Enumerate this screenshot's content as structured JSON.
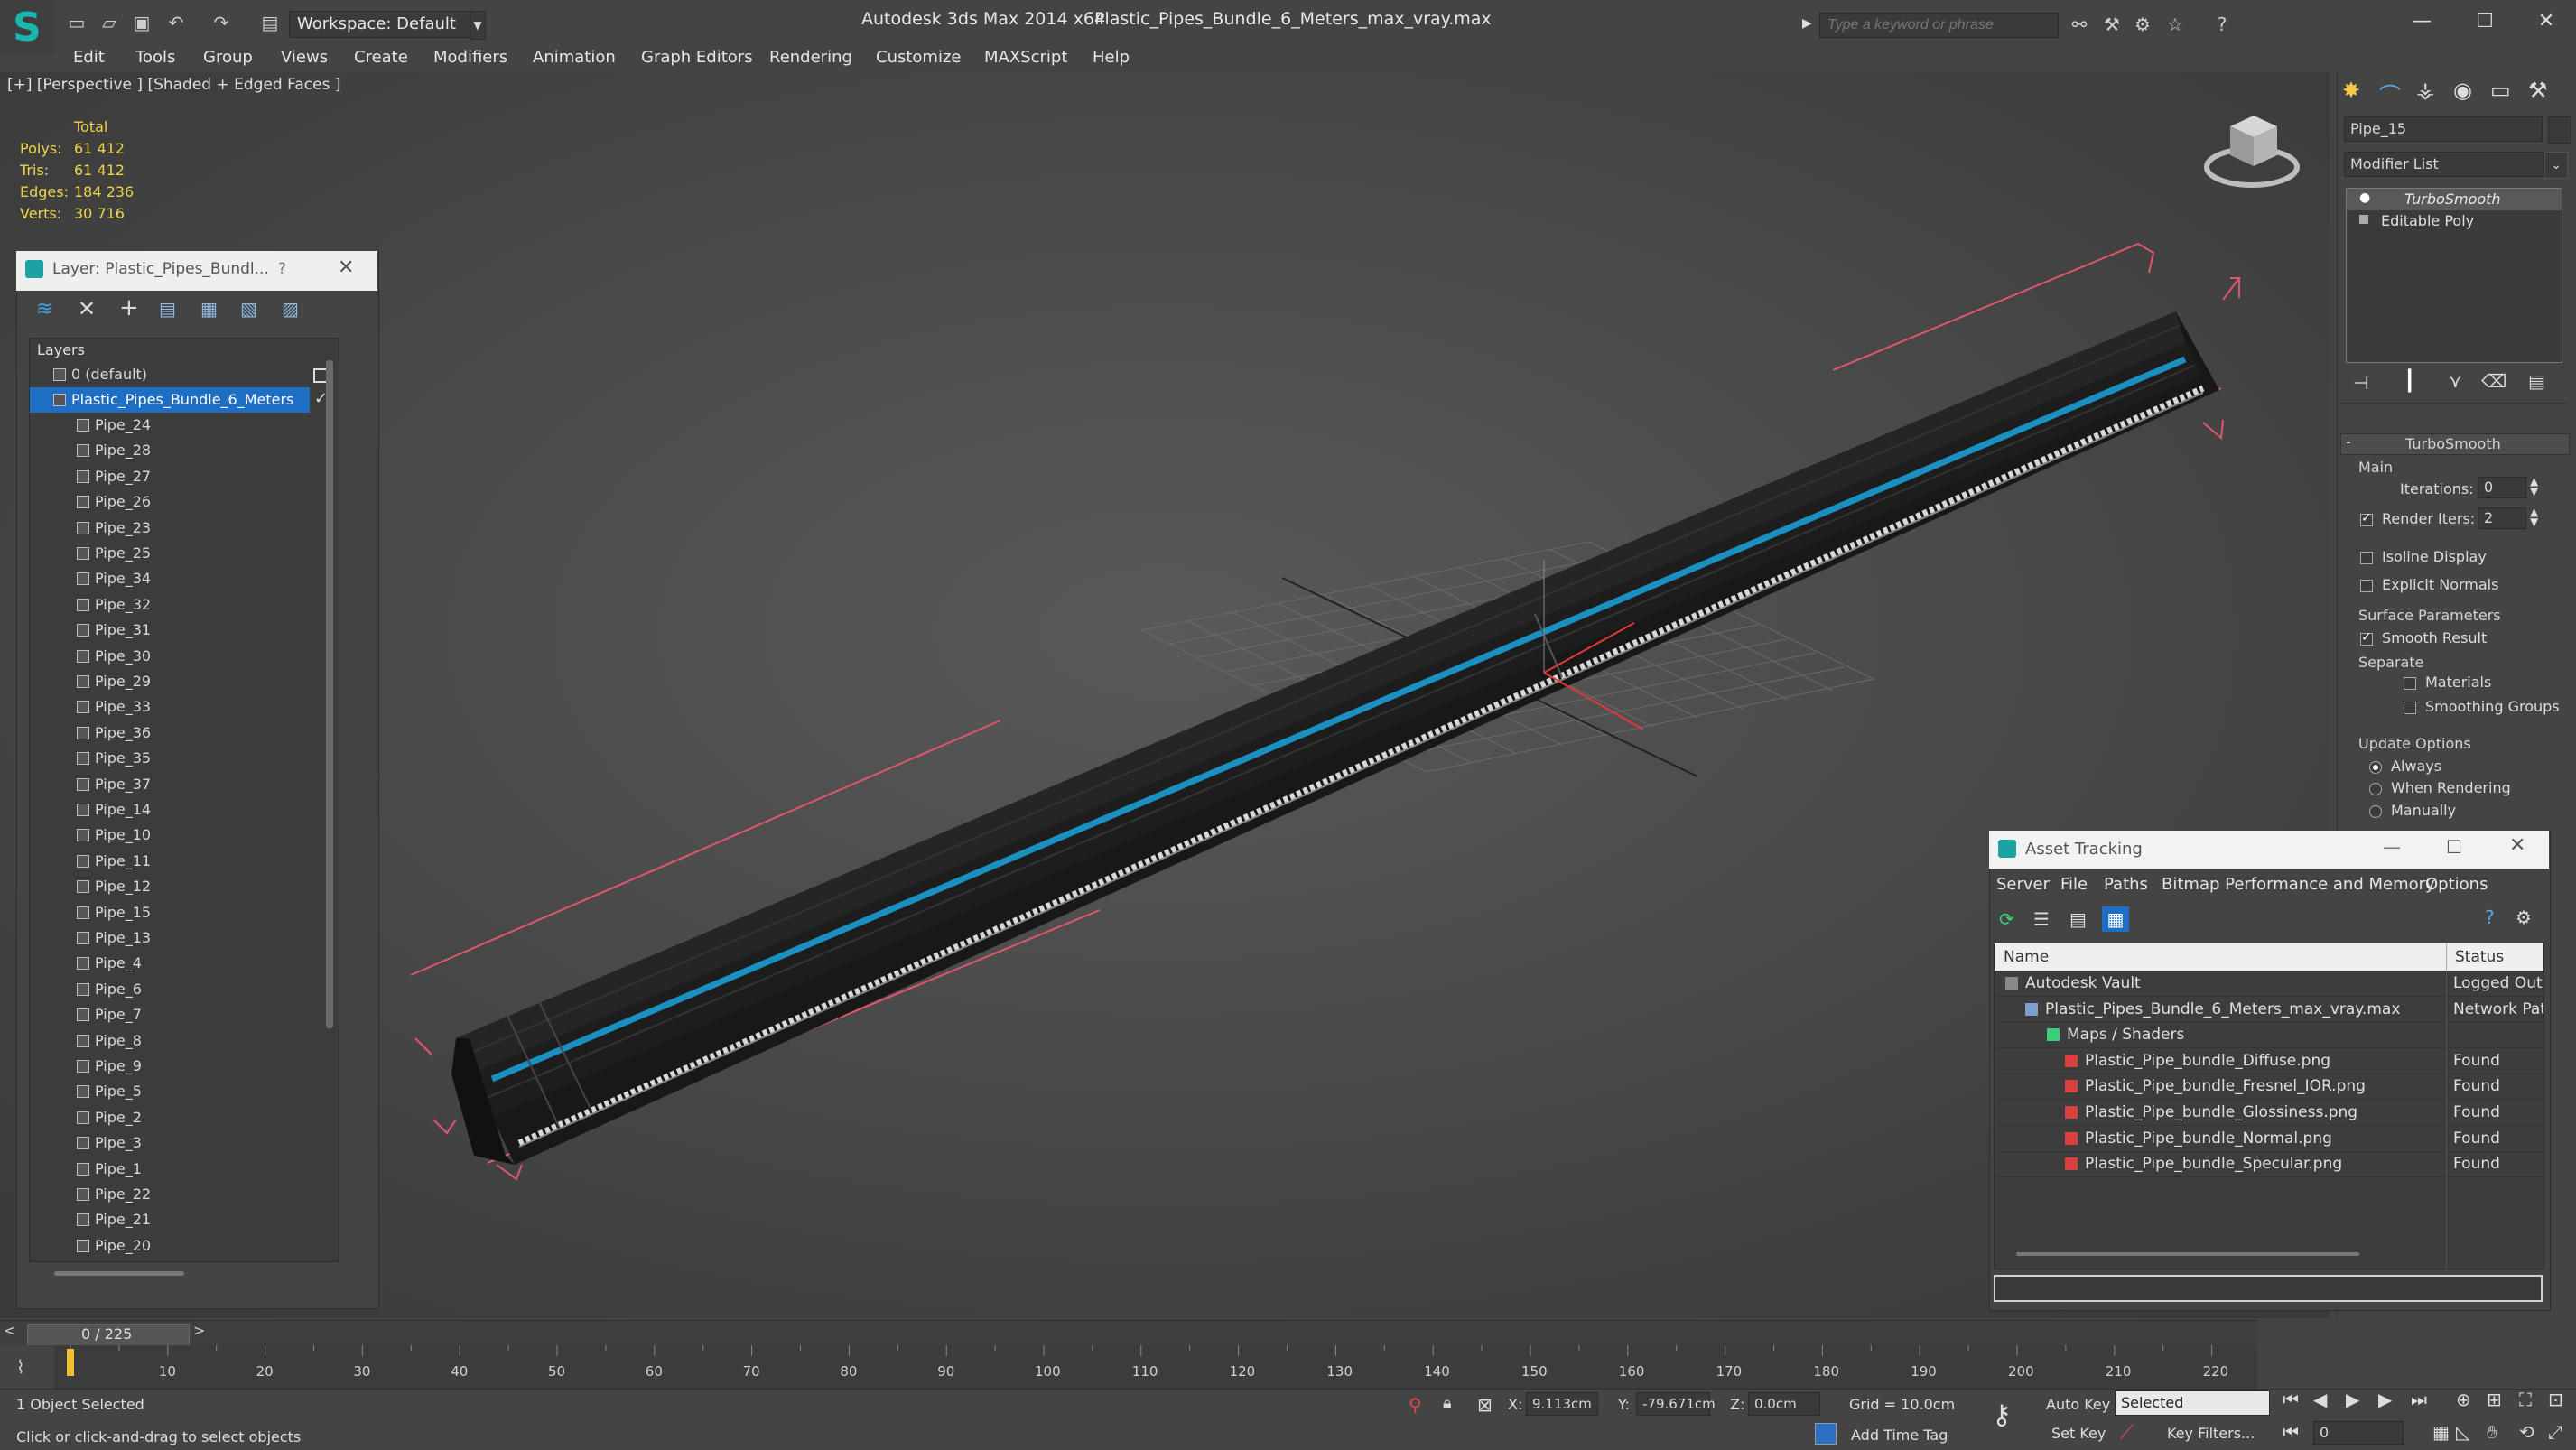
{
  "titlebar": {
    "workspace": "Workspace: Default",
    "app_title": "Autodesk 3ds Max  2014 x64",
    "file_title": "Plastic_Pipes_Bundle_6_Meters_max_vray.max",
    "search_placeholder": "Type a keyword or phrase"
  },
  "menu": [
    "Edit",
    "Tools",
    "Group",
    "Views",
    "Create",
    "Modifiers",
    "Animation",
    "Graph Editors",
    "Rendering",
    "Customize",
    "MAXScript",
    "Help"
  ],
  "viewport": {
    "label": "[+] [Perspective ] [Shaded + Edged Faces ]",
    "stats": {
      "total_label": "Total",
      "polys_label": "Polys:",
      "polys": "61 412",
      "tris_label": "Tris:",
      "tris": "61 412",
      "edges_label": "Edges:",
      "edges": "184 236",
      "verts_label": "Verts:",
      "verts": "30 716"
    }
  },
  "layer_panel": {
    "title": "Layer: Plastic_Pipes_Bundl...",
    "help": "?",
    "header": "Layers",
    "default_layer": "0 (default)",
    "active_layer": "Plastic_Pipes_Bundle_6_Meters",
    "pipes": [
      "Pipe_24",
      "Pipe_28",
      "Pipe_27",
      "Pipe_26",
      "Pipe_23",
      "Pipe_25",
      "Pipe_34",
      "Pipe_32",
      "Pipe_31",
      "Pipe_30",
      "Pipe_29",
      "Pipe_33",
      "Pipe_36",
      "Pipe_35",
      "Pipe_37",
      "Pipe_14",
      "Pipe_10",
      "Pipe_11",
      "Pipe_12",
      "Pipe_15",
      "Pipe_13",
      "Pipe_4",
      "Pipe_6",
      "Pipe_7",
      "Pipe_8",
      "Pipe_9",
      "Pipe_5",
      "Pipe_2",
      "Pipe_3",
      "Pipe_1",
      "Pipe_22",
      "Pipe_21",
      "Pipe_20"
    ]
  },
  "command_panel": {
    "object_name": "Pipe_15",
    "modifier_list": "Modifier List",
    "stack": [
      "TurboSmooth",
      "Editable Poly"
    ],
    "rollout_title": "TurboSmooth",
    "main_label": "Main",
    "iterations_label": "Iterations:",
    "iterations": "0",
    "render_iters_label": "Render Iters:",
    "render_iters": "2",
    "isoline": "Isoline Display",
    "explicit_normals": "Explicit Normals",
    "surface_params": "Surface Parameters",
    "smooth_result": "Smooth Result",
    "separate": "Separate",
    "materials": "Materials",
    "smoothing_groups": "Smoothing Groups",
    "update_options": "Update Options",
    "always": "Always",
    "when_rendering": "When Rendering",
    "manually": "Manually"
  },
  "asset_tracking": {
    "title": "Asset Tracking",
    "menus": [
      "Server",
      "File",
      "Paths",
      "Bitmap Performance and Memory",
      "Options"
    ],
    "col_name": "Name",
    "col_status": "Status",
    "rows": [
      {
        "name": "Autodesk Vault",
        "status": "Logged Out"
      },
      {
        "name": "Plastic_Pipes_Bundle_6_Meters_max_vray.max",
        "status": "Network Pat"
      },
      {
        "name": "Maps / Shaders",
        "status": ""
      },
      {
        "name": "Plastic_Pipe_bundle_Diffuse.png",
        "status": "Found"
      },
      {
        "name": "Plastic_Pipe_bundle_Fresnel_IOR.png",
        "status": "Found"
      },
      {
        "name": "Plastic_Pipe_bundle_Glossiness.png",
        "status": "Found"
      },
      {
        "name": "Plastic_Pipe_bundle_Normal.png",
        "status": "Found"
      },
      {
        "name": "Plastic_Pipe_bundle_Specular.png",
        "status": "Found"
      }
    ]
  },
  "timeline": {
    "frame": "0 / 225",
    "ticks": [
      "10",
      "20",
      "30",
      "40",
      "50",
      "60",
      "70",
      "80",
      "90",
      "100",
      "110",
      "120",
      "130",
      "140",
      "150",
      "160",
      "170",
      "180",
      "190",
      "200",
      "210",
      "220"
    ]
  },
  "status": {
    "selected": "1 Object Selected",
    "prompt": "Click or click-and-drag to select objects",
    "x_label": "X:",
    "x": "9.113cm",
    "y_label": "Y:",
    "y": "-79.671cm",
    "z_label": "Z:",
    "z": "0.0cm",
    "grid": "Grid = 10.0cm",
    "add_time_tag": "Add Time Tag",
    "auto_key": "Auto Key",
    "set_key": "Set Key",
    "selected_dropdown": "Selected",
    "key_filters": "Key Filters...",
    "frame_field": "0"
  },
  "colors": {
    "accent_blue": "#1e6fc4",
    "stats_yellow": "#ecd44a",
    "bbox_pink": "#e0566b",
    "pipe_cyan": "#1a8fc0"
  }
}
